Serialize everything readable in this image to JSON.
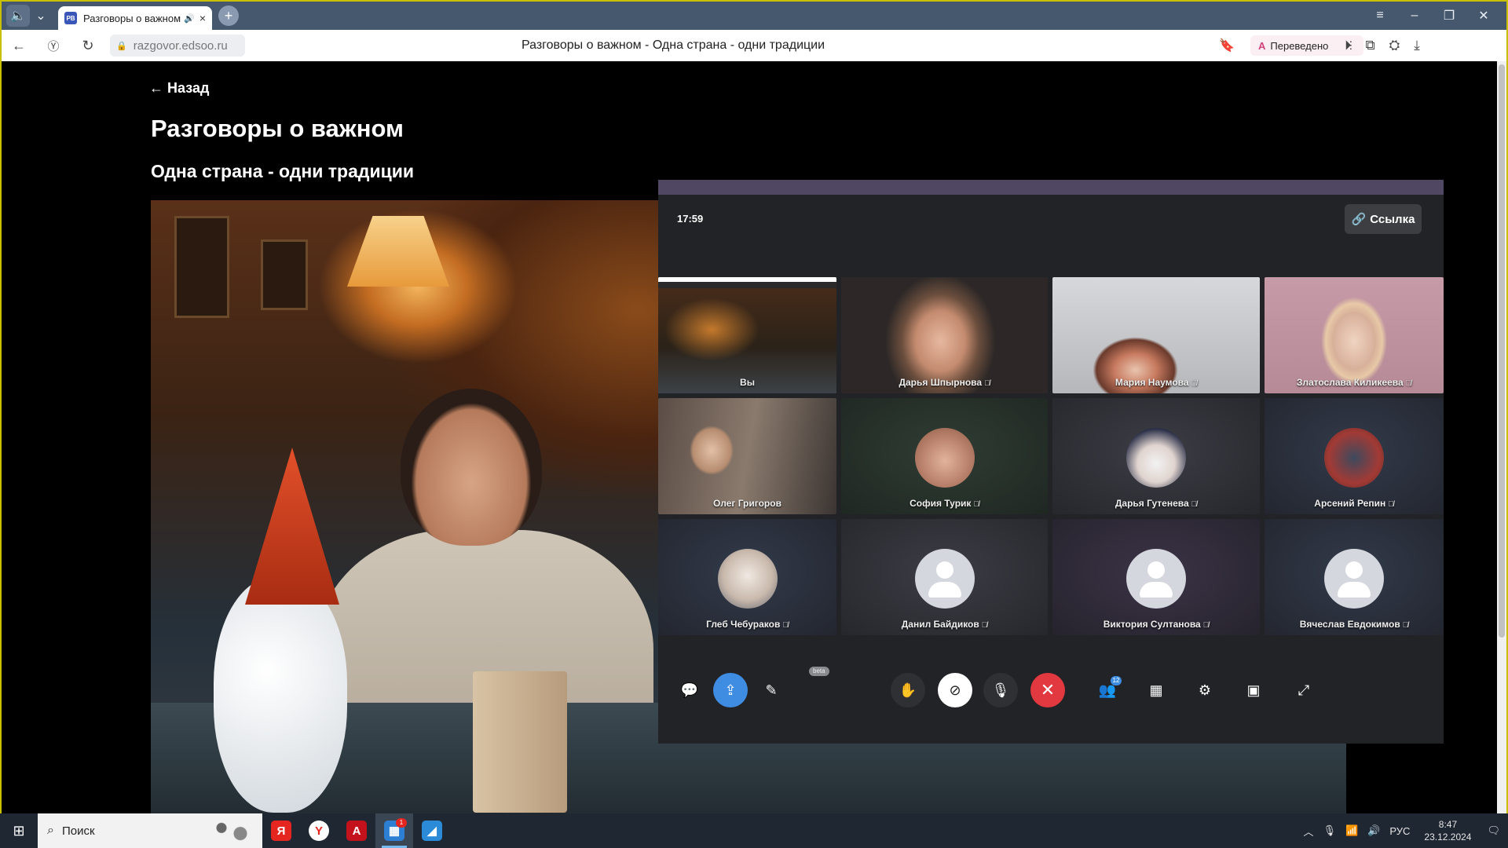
{
  "browser": {
    "tab": {
      "title": "Разговоры о важном",
      "favicon": "РВ",
      "sound_icon": "speaker-icon",
      "close": "×"
    },
    "new_tab": "+",
    "window_controls": [
      "≡",
      "–",
      "❐",
      "✕"
    ],
    "url": "razgovor.edsoo.ru",
    "page_title": "Разговоры о важном - Одна страна - одни традиции",
    "translated_label": "Переведено"
  },
  "page": {
    "back_label": "← Назад",
    "title": "Разговоры о важном",
    "subtitle": "Одна страна - одни традиции"
  },
  "conference": {
    "timer": "17:59",
    "link_label": "Ссылка",
    "participants": [
      {
        "name": "Вы",
        "kind": "camera-you",
        "muted": false,
        "active": true
      },
      {
        "name": "Дарья Шпырнова",
        "kind": "camera-d1",
        "muted": true
      },
      {
        "name": "Мария Наумова",
        "kind": "camera-d2",
        "muted": true
      },
      {
        "name": "Златослава Киликеева",
        "kind": "camera-d3",
        "muted": true
      },
      {
        "name": "Олег Григоров",
        "kind": "camera-d4",
        "muted": false
      },
      {
        "name": "София Турик",
        "kind": "photo-sofia",
        "muted": true
      },
      {
        "name": "Дарья Гутенева",
        "kind": "photo-darya",
        "muted": true
      },
      {
        "name": "Арсений Репин",
        "kind": "photo-arseniy",
        "muted": true
      },
      {
        "name": "Глеб Чебураков",
        "kind": "photo-gleb",
        "muted": true
      },
      {
        "name": "Данил Байдиков",
        "kind": "default",
        "muted": true
      },
      {
        "name": "Виктория Султанова",
        "kind": "default",
        "muted": true
      },
      {
        "name": "Вячеслав Евдокимов",
        "kind": "default",
        "muted": true
      }
    ],
    "controls": {
      "beta_label": "beta",
      "participants_count": "12"
    }
  },
  "taskbar": {
    "search_label": "Поиск",
    "language": "РУС",
    "time": "8:47",
    "date": "23.12.2024",
    "app_badge": "1"
  },
  "colors": {
    "active_tile_border": "#34c75a",
    "end_call": "#e2383f",
    "share_button": "#3e8de3",
    "conference_header": "#504863"
  }
}
